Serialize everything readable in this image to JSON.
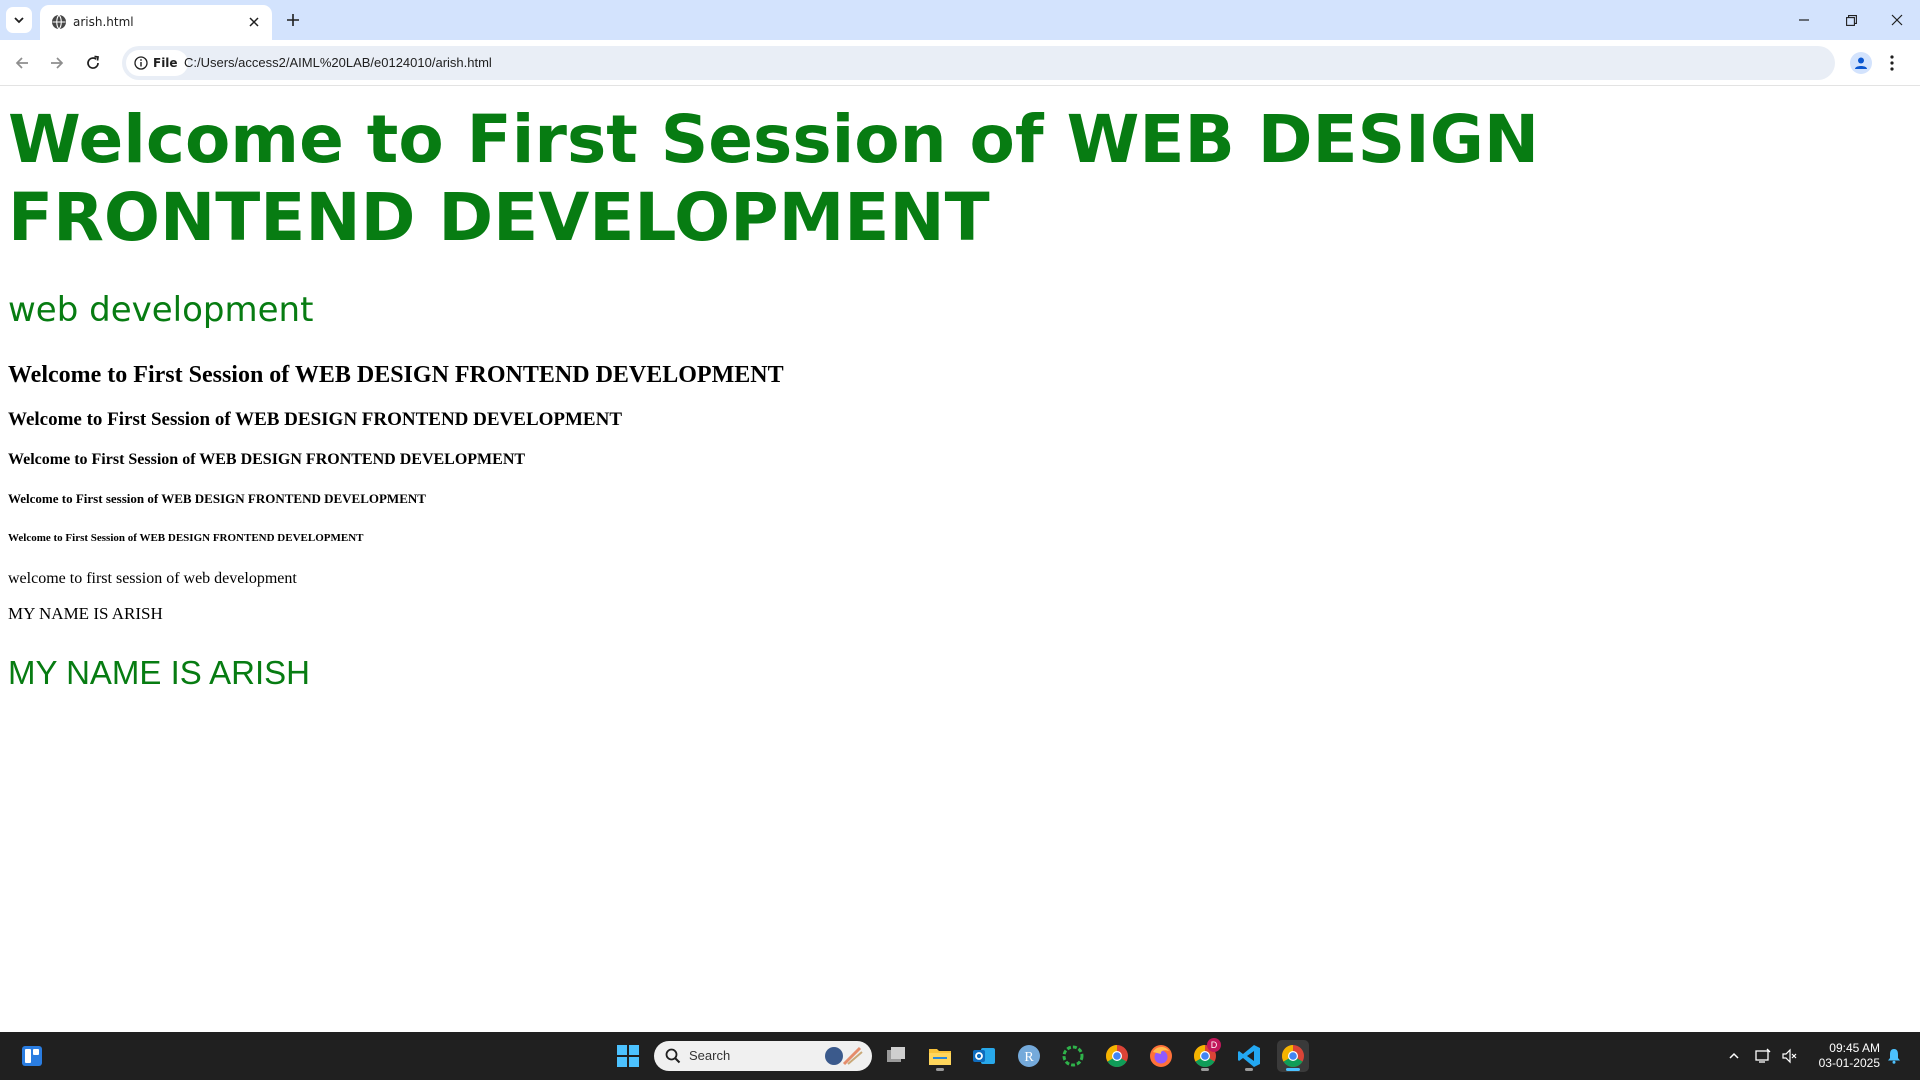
{
  "browser": {
    "tab_title": "arish.html",
    "site_chip_label": "File",
    "url": "C:/Users/access2/AIML%20LAB/e0124010/arish.html",
    "icons": {
      "tab_search": "chevron-down-icon",
      "favicon": "globe-icon",
      "tab_close": "close-icon",
      "new_tab": "plus-icon",
      "back": "arrow-left-icon",
      "forward": "arrow-right-icon",
      "reload": "reload-icon",
      "site_info": "info-icon",
      "bookmark": "star-icon",
      "profile": "person-icon",
      "menu": "kebab-menu-icon",
      "minimize": "minimize-icon",
      "restore": "restore-icon",
      "close_window": "close-icon"
    }
  },
  "page": {
    "heading1": "Welcome to First Session of WEB DESIGN FRONTEND DEVELOPMENT",
    "subheading": "web development",
    "heading2": "Welcome to First Session of WEB DESIGN FRONTEND DEVELOPMENT",
    "heading3": "Welcome to First Session of WEB DESIGN FRONTEND DEVELOPMENT",
    "heading4": "Welcome to First Session of WEB DESIGN FRONTEND DEVELOPMENT",
    "heading5": "Welcome to First session of WEB DESIGN FRONTEND DEVELOPMENT",
    "heading6": "Welcome to First Session of WEB DESIGN FRONTEND DEVELOPMENT",
    "paragraph": "welcome to first session of web development",
    "name_line": "MY NAME IS ARISH",
    "name_line_large": "MY NAME IS ARISH",
    "colors": {
      "green_text": "#077c12",
      "black_text": "#000000"
    }
  },
  "taskbar": {
    "search_label": "Search",
    "clock_time": "09:45 AM",
    "clock_date": "03-01-2025",
    "chrome_badge": "D",
    "apps": [
      "widgets-icon",
      "start-icon",
      "task-view-icon",
      "file-explorer-icon",
      "outlook-icon",
      "r-app-icon",
      "loading-app-icon",
      "chrome-icon",
      "firefox-icon",
      "chrome-profile-icon",
      "vscode-icon",
      "chrome-active-icon"
    ],
    "colors": {
      "background": "#202020",
      "accent": "#4cc2ff"
    }
  }
}
